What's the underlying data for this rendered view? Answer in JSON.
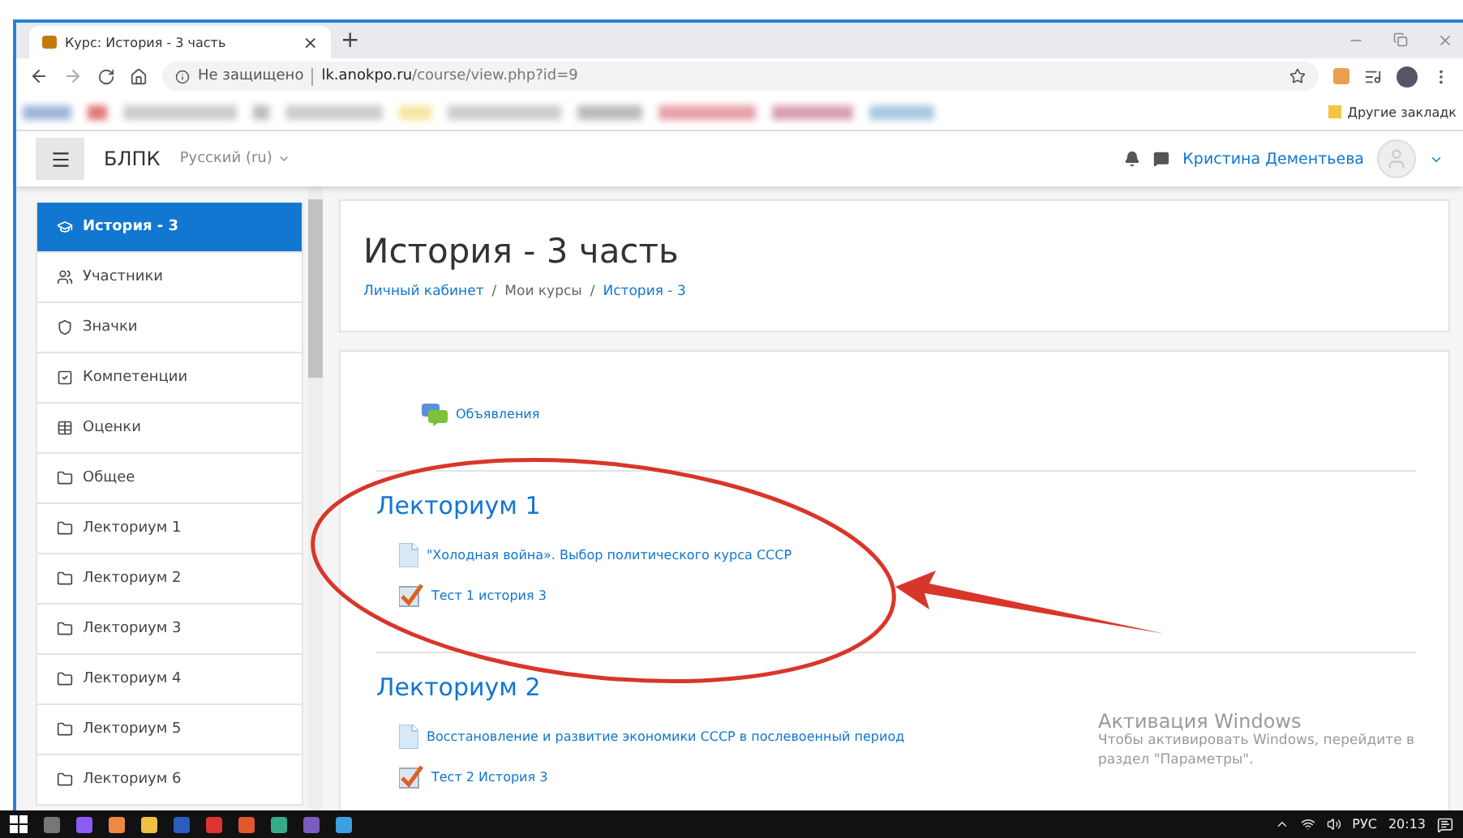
{
  "browser": {
    "tab": {
      "title": "Курс: История - 3 часть",
      "close": "×"
    },
    "new_tab": "+",
    "address": {
      "security": "Не защищено",
      "host": "lk.anokpo.ru",
      "path": "/course/view.php?id=9"
    },
    "other_bookmarks": "Другие закладк"
  },
  "navbar": {
    "site": "БЛПК",
    "language": "Русский (ru)",
    "user": "Кристина Дементьева"
  },
  "sidebar": {
    "items": [
      {
        "label": "История - 3",
        "kind": "course",
        "selected": true
      },
      {
        "label": "Участники",
        "kind": "participants",
        "selected": false
      },
      {
        "label": "Значки",
        "kind": "badges",
        "selected": false
      },
      {
        "label": "Компетенции",
        "kind": "competencies",
        "selected": false
      },
      {
        "label": "Оценки",
        "kind": "grades",
        "selected": false
      },
      {
        "label": "Общее",
        "kind": "section",
        "selected": false
      },
      {
        "label": "Лекториум 1",
        "kind": "section",
        "selected": false
      },
      {
        "label": "Лекториум 2",
        "kind": "section",
        "selected": false
      },
      {
        "label": "Лекториум 3",
        "kind": "section",
        "selected": false
      },
      {
        "label": "Лекториум 4",
        "kind": "section",
        "selected": false
      },
      {
        "label": "Лекториум 5",
        "kind": "section",
        "selected": false
      },
      {
        "label": "Лекториум 6",
        "kind": "section",
        "selected": false
      }
    ]
  },
  "course": {
    "title": "История - 3 часть",
    "separator": "/",
    "breadcrumb": [
      {
        "label": "Личный кабинет",
        "link": true
      },
      {
        "label": "Мои курсы",
        "link": false
      },
      {
        "label": "История - 3",
        "link": true
      }
    ]
  },
  "sections": [
    {
      "activities": [
        {
          "kind": "forum",
          "label": "Объявления"
        }
      ]
    },
    {
      "title": "Лекториум 1",
      "activities": [
        {
          "kind": "page",
          "label": "\"Холодная война». Выбор политического курса СССР"
        },
        {
          "kind": "quiz",
          "label": "Тест 1 история 3"
        }
      ]
    },
    {
      "title": "Лекториум 2",
      "activities": [
        {
          "kind": "page",
          "label": "Восстановление и развитие экономики СССР в послевоенный период"
        },
        {
          "kind": "quiz",
          "label": "Тест 2 История 3"
        }
      ]
    }
  ],
  "activation": {
    "title": "Активация Windows",
    "text": "Чтобы активировать Windows, перейдите в раздел \"Параметры\"."
  },
  "taskbar": {
    "language": "РУС",
    "time": "20:13"
  }
}
